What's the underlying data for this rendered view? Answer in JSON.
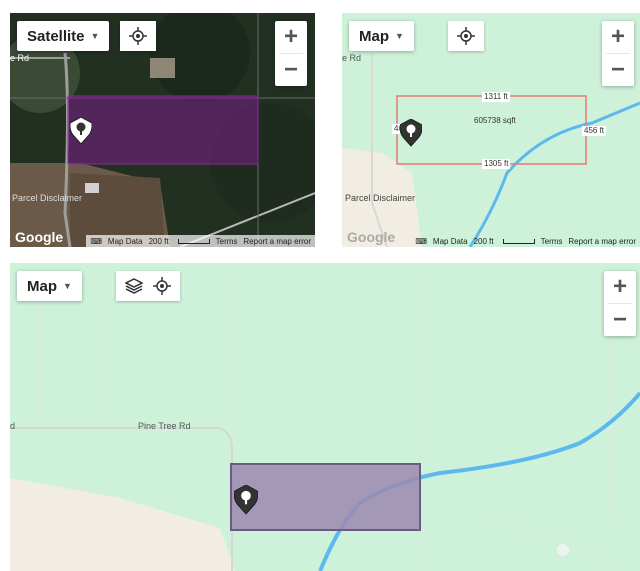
{
  "satellite_panel": {
    "map_type_label": "Satellite",
    "road_label": "e Rd",
    "disclaimer": "Parcel Disclaimer",
    "google_logo": "Google",
    "footer": {
      "map_data": "Map Data",
      "scale": "200 ft",
      "terms": "Terms",
      "report": "Report a map error"
    }
  },
  "map_panel": {
    "map_type_label": "Map",
    "road_label": "e Rd",
    "disclaimer": "Parcel Disclaimer",
    "google_logo": "Google",
    "dimensions": {
      "top": "1311 ft",
      "bottom": "1305 ft",
      "left": "468 ft",
      "right": "456 ft",
      "area": "605738 sqft"
    },
    "footer": {
      "map_data": "Map Data",
      "scale": "200 ft",
      "terms": "Terms",
      "report": "Report a map error"
    }
  },
  "large_panel": {
    "map_type_label": "Map",
    "road_label": "Pine Tree Rd",
    "road_label_left": "d"
  },
  "icons": {
    "locate": "crosshair-icon",
    "layers": "layers-icon",
    "pin": "tree-pin-icon"
  },
  "colors": {
    "map_green": "#cdf2d9",
    "sand": "#f1ede2",
    "parcel_fill": "#9b8ab0",
    "parcel_outline": "#6b5a82",
    "water": "#5cb9f0",
    "sat_parcel": "#7a1f8a",
    "dim_outline": "#e57b72"
  },
  "zoom": {
    "plus": "+",
    "minus": "−"
  }
}
